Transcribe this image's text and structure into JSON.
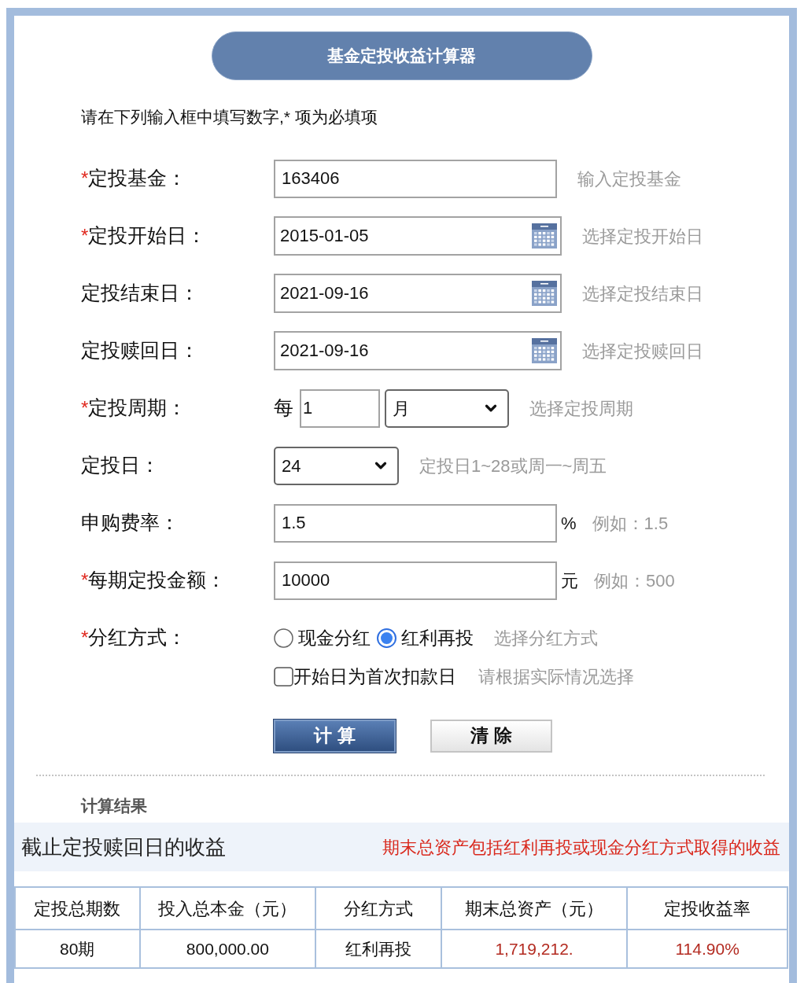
{
  "title": "基金定投收益计算器",
  "instruction": "请在下列输入框中填写数字,* 项为必填项",
  "form": [
    {
      "kind": "text",
      "required_mark": "*",
      "label": "定投基金：",
      "value": "163406",
      "hint": "输入定投基金"
    },
    {
      "kind": "date",
      "required_mark": "*",
      "label": "定投开始日：",
      "value": "2015-01-05",
      "hint": "选择定投开始日"
    },
    {
      "kind": "date",
      "label": "定投结束日：",
      "value": "2021-09-16",
      "hint": "选择定投结束日"
    },
    {
      "kind": "date",
      "label": "定投赎回日：",
      "value": "2021-09-16",
      "hint": "选择定投赎回日"
    },
    {
      "kind": "period",
      "required_mark": "*",
      "label": "定投周期：",
      "prefix": "每",
      "value": "1",
      "unit": "月",
      "hint": "选择定投周期"
    },
    {
      "kind": "select",
      "label": "定投日：",
      "value": "24",
      "hint": "定投日1~28或周一~周五"
    },
    {
      "kind": "unit",
      "label": "申购费率：",
      "value": "1.5",
      "unit": "%",
      "hint": "例如：1.5"
    },
    {
      "kind": "unit",
      "required_mark": "*",
      "label": "每期定投金额：",
      "value": "10000",
      "unit": "元",
      "hint": "例如：500"
    },
    {
      "kind": "radio",
      "required_mark": "*",
      "label": "分红方式：",
      "options": [
        {
          "label": "现金分红",
          "selected": false
        },
        {
          "label": "红利再投",
          "selected": true
        }
      ],
      "hint": "选择分红方式"
    },
    {
      "kind": "checkbox",
      "label": "开始日为首次扣款日",
      "checked": false,
      "hint": "请根据实际情况选择"
    }
  ],
  "buttons": [
    {
      "kind": "primary",
      "label": "计 算"
    },
    {
      "kind": "default",
      "label": "清 除"
    }
  ],
  "results": {
    "heading": "计算结果",
    "banner": {
      "title": "截止定投赎回日的收益",
      "note": "期末总资产包括红利再投或现金分红方式取得的收益"
    },
    "table": {
      "columns": [
        "定投总期数",
        "投入总本金（元）",
        "分红方式",
        "期末总资产（元）",
        "定投收益率"
      ],
      "rows": [
        [
          {
            "text": "80期",
            "highlight": false
          },
          {
            "text": "800,000.00",
            "highlight": false
          },
          {
            "text": "红利再投",
            "highlight": false
          },
          {
            "text": "1,719,212.",
            "highlight": true
          },
          {
            "text": "114.90%",
            "highlight": true
          }
        ]
      ]
    }
  }
}
